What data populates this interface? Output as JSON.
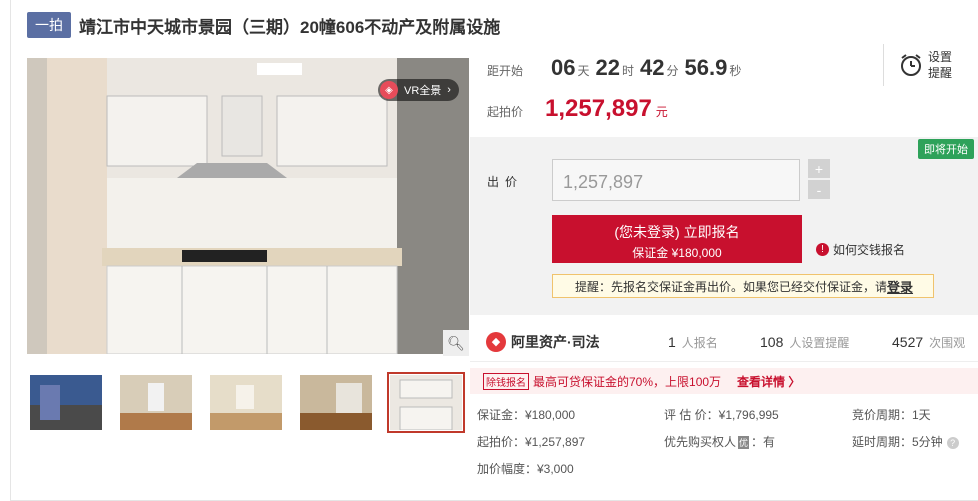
{
  "header": {
    "tag": "一拍",
    "title": "靖江市中天城市景园（三期）20幢606不动产及附属设施"
  },
  "gallery": {
    "vr_label": "VR全景",
    "watermark": "法拍",
    "thumb_count": 5,
    "active_thumb": 5
  },
  "countdown": {
    "label": "距开始",
    "days": "06",
    "days_unit": "天",
    "hours": "22",
    "hours_unit": "时",
    "minutes": "42",
    "minutes_unit": "分",
    "seconds": "56.9",
    "seconds_unit": "秒"
  },
  "start_price": {
    "label": "起拍价",
    "value": "1,257,897",
    "unit": "元"
  },
  "reminder": {
    "line1": "设置",
    "line2": "提醒"
  },
  "bid": {
    "soon_badge": "即将开始",
    "label": "出价",
    "input_value": "1,257,897",
    "plus": "+",
    "minus": "-",
    "register_line1": "(您未登录) 立即报名",
    "register_line2": "保证金 ¥180,000",
    "how_pay": "如何交钱报名",
    "tip_text": "提醒：先报名交保证金再出价。如果您已经交付保证金，请",
    "tip_login": "登录"
  },
  "stats": {
    "brand": "阿里资产·司法",
    "signups": "1",
    "signups_label": "人报名",
    "reminders": "108",
    "reminders_label": "人设置提醒",
    "views": "4527",
    "views_label": "次围观"
  },
  "loan": {
    "badge": "除钱报名",
    "text": "最高可贷保证金的70%，上限100万",
    "more": "查看详情 〉"
  },
  "details": {
    "deposit": "保证金：¥180,000",
    "appraisal": "评 估 价：¥1,796,995",
    "bid_cycle": "竞价周期：1天",
    "start_price": "起拍价：¥1,257,897",
    "priority_label": "优先购买权人",
    "priority_badge": "优",
    "priority_value": "：有",
    "delay_cycle": "延时周期：5分钟",
    "increment": "加价幅度：¥3,000"
  },
  "colors": {
    "accent": "#c8102e",
    "tag_bg": "#5b6fa3",
    "soon_green": "#2ea25a"
  }
}
